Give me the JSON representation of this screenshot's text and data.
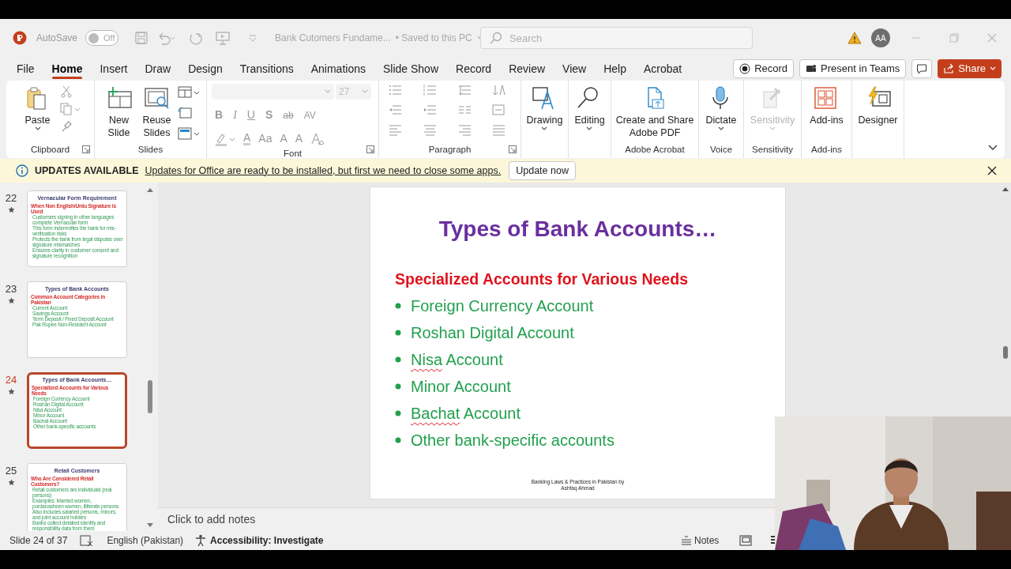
{
  "title_bar": {
    "autosave_label": "AutoSave",
    "autosave": {
      "on": false,
      "label": "Off"
    },
    "document_title": "Bank Cutomers Fundame...",
    "save_status": "• Saved to this PC",
    "search": {
      "placeholder": "Search"
    },
    "avatar": "AA"
  },
  "menu_tabs": [
    {
      "label": "File",
      "selected": false
    },
    {
      "label": "Home",
      "selected": true
    },
    {
      "label": "Insert",
      "selected": false
    },
    {
      "label": "Draw",
      "selected": false
    },
    {
      "label": "Design",
      "selected": false
    },
    {
      "label": "Transitions",
      "selected": false
    },
    {
      "label": "Animations",
      "selected": false
    },
    {
      "label": "Slide Show",
      "selected": false
    },
    {
      "label": "Record",
      "selected": false
    },
    {
      "label": "Review",
      "selected": false
    },
    {
      "label": "View",
      "selected": false
    },
    {
      "label": "Help",
      "selected": false
    },
    {
      "label": "Acrobat",
      "selected": false
    }
  ],
  "menu_buttons": [
    {
      "kind": "record",
      "label": "Record"
    },
    {
      "kind": "teams",
      "label": "Present in Teams"
    },
    {
      "kind": "comments"
    },
    {
      "kind": "share",
      "label": "Share"
    }
  ],
  "ribbon": [
    {
      "kind": "clipboard",
      "label": "Clipboard",
      "commands": [
        {
          "label": "Paste",
          "disabled": false
        }
      ]
    },
    {
      "kind": "slides",
      "label": "Slides",
      "commands": [
        {
          "label": "New Slide",
          "disabled": false
        },
        {
          "label": "Reuse Slides",
          "disabled": false
        }
      ]
    },
    {
      "kind": "font",
      "label": "Font",
      "font_size": "27",
      "row1": [
        "B",
        "I",
        "U",
        "S",
        "ab",
        "AV"
      ],
      "row2": [
        "A",
        "Aa",
        "A",
        "A"
      ]
    },
    {
      "kind": "paragraph",
      "label": "Paragraph"
    },
    {
      "kind": "drawing",
      "commands": [
        {
          "label": "Drawing",
          "disabled": false
        }
      ]
    },
    {
      "kind": "editing",
      "commands": [
        {
          "label": "Editing",
          "disabled": false
        }
      ]
    },
    {
      "kind": "acrobat",
      "label": "Adobe Acrobat",
      "commands": [
        {
          "label": "Create and Share Adobe PDF",
          "disabled": false
        }
      ]
    },
    {
      "kind": "voice",
      "label": "Voice",
      "commands": [
        {
          "label": "Dictate",
          "disabled": false
        }
      ]
    },
    {
      "kind": "sensitivity",
      "label": "Sensitivity",
      "commands": [
        {
          "label": "Sensitivity",
          "disabled": true
        }
      ]
    },
    {
      "kind": "addins",
      "label": "Add-ins",
      "commands": [
        {
          "label": "Add-ins",
          "disabled": false
        }
      ]
    },
    {
      "kind": "designer",
      "commands": [
        {
          "label": "Designer",
          "disabled": false
        }
      ]
    }
  ],
  "update_bar": {
    "title": "UPDATES AVAILABLE",
    "message": "Updates for Office are ready to be installed, but first we need to close some apps.",
    "button": "Update now"
  },
  "thumbnails": [
    {
      "number": "22",
      "selected": false,
      "title": "Vernacular Form Requirement",
      "subtitle": "When Non English/Urdu Signature is Used",
      "bullets": [
        "Customers signing in other languages complete Vernacular form",
        "This form indemnifies the bank for mis-verification risks",
        "Protects the bank from legal disputes over signature mismatches",
        "Ensures clarity in customer consent and signature recognition"
      ]
    },
    {
      "number": "23",
      "selected": false,
      "title": "Types of Bank Accounts",
      "subtitle": "Common Account Categories in Pakistan",
      "bullets": [
        "Current Account",
        "Savings Account",
        "Term Deposit / Fixed Deposit Account",
        "Pak Rupee Non-Resident Account"
      ]
    },
    {
      "number": "24",
      "selected": true,
      "title": "Types of Bank Accounts…",
      "subtitle": "Specialized Accounts for Various Needs",
      "bullets": [
        "Foreign Currency Account",
        "Roshan Digital Account",
        "Nisa Account",
        "Minor Account",
        "Bachat Account",
        "Other bank-specific accounts"
      ]
    },
    {
      "number": "25",
      "selected": false,
      "title": "Retail Customers",
      "subtitle": "Who Are Considered Retail Customers?",
      "bullets": [
        "Retail customers are individuals (real persons)",
        "Examples: Married women, purdanasheen women, illiterate persons",
        "Also includes salaried persons, minors, and joint account holders",
        "Banks collect detailed identity and responsibility data from them"
      ]
    }
  ],
  "slide": {
    "title": "Types of Bank Accounts…",
    "subtitle": "Specialized Accounts for Various Needs",
    "bullets": [
      {
        "text": "Foreign Currency Account",
        "misspelled": false
      },
      {
        "text": "Roshan Digital Account",
        "misspelled": false
      },
      {
        "text": "Nisa Account",
        "misspelled": true
      },
      {
        "text": "Minor Account",
        "misspelled": false
      },
      {
        "text": "Bachat Account",
        "misspelled": true
      },
      {
        "text": "Other bank-specific accounts",
        "misspelled": false
      }
    ],
    "footer": [
      "Banking Laws & Practices in Pakistan by",
      "Ashfaq Ahmad"
    ]
  },
  "notes_placeholder": "Click to add notes",
  "status_bar": {
    "slide_info": "Slide 24 of 37",
    "language": "English (Pakistan)",
    "accessibility": "Accessibility: Investigate",
    "notes": "Notes"
  }
}
